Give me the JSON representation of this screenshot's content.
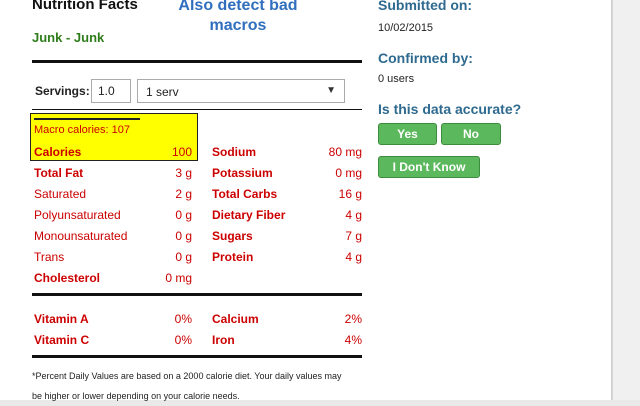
{
  "nutrition": {
    "title": "Nutrition Facts",
    "overlay_note": "Also detect bad macros",
    "food_name": "Junk - Junk",
    "servings_label": "Servings:",
    "servings_value": "1.0",
    "serving_unit": "1 serv",
    "macro_calories": "Macro calories: 107",
    "calories": {
      "label": "Calories",
      "value": "100"
    },
    "left_rows": [
      {
        "label": "Total Fat",
        "value": "3 g"
      },
      {
        "label": "Saturated",
        "value": "2 g"
      },
      {
        "label": "Polyunsaturated",
        "value": "0 g"
      },
      {
        "label": "Monounsaturated",
        "value": "0 g"
      },
      {
        "label": "Trans",
        "value": "0 g"
      },
      {
        "label": "Cholesterol",
        "value": "0 mg"
      }
    ],
    "right_rows": [
      {
        "label": "Sodium",
        "value": "80 mg"
      },
      {
        "label": "Potassium",
        "value": "0 mg"
      },
      {
        "label": "Total Carbs",
        "value": "16 g"
      },
      {
        "label": "Dietary Fiber",
        "value": "4 g"
      },
      {
        "label": "Sugars",
        "value": "7 g"
      },
      {
        "label": "Protein",
        "value": "4 g"
      }
    ],
    "vitamins": [
      {
        "label": "Vitamin A",
        "value": "0%"
      },
      {
        "label": "Calcium",
        "value": "2%"
      },
      {
        "label": "Vitamin C",
        "value": "0%"
      },
      {
        "label": "Iron",
        "value": "4%"
      }
    ],
    "footnote": "*Percent Daily Values are based on a 2000 calorie diet. Your daily values may be higher or lower depending on your calorie needs."
  },
  "sidebar": {
    "submitted_label": "Submitted on:",
    "submitted_date": "10/02/2015",
    "confirmed_label": "Confirmed by:",
    "confirmed_count": "0 users",
    "accurate_question": "Is this data accurate?",
    "yes_label": "Yes",
    "no_label": "No",
    "dont_know_label": "I Don't Know"
  },
  "colors": {
    "nutrient_red": "#cc0000",
    "highlight_yellow": "#ffff00",
    "button_green": "#5cb85c",
    "heading_blue": "#2e6a8f",
    "overlay_blue": "#2f6fbe",
    "food_green": "#2e7d1a"
  }
}
